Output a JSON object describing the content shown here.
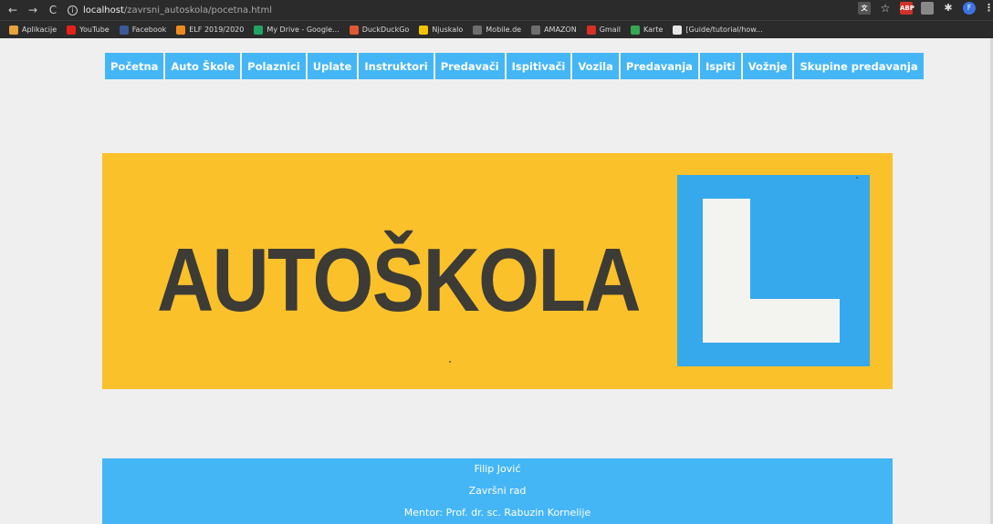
{
  "browser": {
    "url_host": "localhost",
    "url_path": "/zavrsni_autoskola/pocetna.html",
    "bookmarks": [
      {
        "label": "Aplikacije",
        "icon": "apps-grid-icon",
        "color": "#e8a33a"
      },
      {
        "label": "YouTube",
        "icon": "youtube-icon",
        "color": "#e62117"
      },
      {
        "label": "Facebook",
        "icon": "facebook-icon",
        "color": "#3b5998"
      },
      {
        "label": "ELF 2019/2020",
        "icon": "elf-icon",
        "color": "#f08a1c"
      },
      {
        "label": "My Drive - Google...",
        "icon": "google-drive-icon",
        "color": "#1fa463"
      },
      {
        "label": "DuckDuckGo",
        "icon": "duckduckgo-icon",
        "color": "#de5833"
      },
      {
        "label": "Njuskalo",
        "icon": "njuskalo-icon",
        "color": "#f5c400"
      },
      {
        "label": "Mobile.de",
        "icon": "mobile-de-icon",
        "color": "#6e6e6e"
      },
      {
        "label": "AMAZON",
        "icon": "amazon-icon",
        "color": "#6e6e6e"
      },
      {
        "label": "Gmail",
        "icon": "gmail-icon",
        "color": "#d93025"
      },
      {
        "label": "Karte",
        "icon": "maps-icon",
        "color": "#34a853"
      },
      {
        "label": "[Guide/tutorial/how...",
        "icon": "page-icon",
        "color": "#e6e6e6"
      }
    ],
    "extensions": [
      "translate-icon",
      "star-icon",
      "adblock-icon",
      "extension-icon",
      "puzzle-icon"
    ],
    "profile_initial": "F"
  },
  "menu": [
    "Početna",
    "Auto Škole",
    "Polaznici",
    "Uplate",
    "Instruktori",
    "Predavači",
    "Ispitivači",
    "Vozila",
    "Predavanja",
    "Ispiti",
    "Vožnje",
    "Skupine predavanja"
  ],
  "banner": {
    "text": "AUTOŠKOLA",
    "letter": "L"
  },
  "footer": {
    "author": "Filip Jović",
    "subtitle": "Završni rad",
    "mentor": "Mentor: Prof. dr. sc. Rabuzin Kornelije"
  },
  "colors": {
    "accent": "#45b6f5",
    "banner_yellow": "#fbc12b",
    "banner_blue": "#35a9ec"
  }
}
